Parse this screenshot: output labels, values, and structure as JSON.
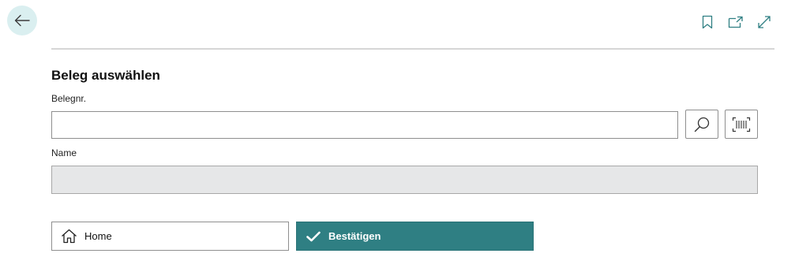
{
  "header": {
    "back_icon": "arrow-left-icon",
    "actions": [
      {
        "icon": "bookmark-icon"
      },
      {
        "icon": "open-in-new-window-icon"
      },
      {
        "icon": "expand-icon"
      }
    ]
  },
  "form": {
    "title": "Beleg auswählen",
    "document_no": {
      "label": "Belegnr.",
      "value": "",
      "search_icon": "search-icon",
      "scan_icon": "barcode-scan-icon"
    },
    "name": {
      "label": "Name",
      "value": ""
    }
  },
  "buttons": {
    "home": {
      "label": "Home",
      "icon": "home-icon"
    },
    "confirm": {
      "label": "Bestätigen",
      "icon": "checkmark-icon"
    }
  },
  "colors": {
    "accent": "#2f7f83",
    "back_button_bg": "#daeff0",
    "icon_teal": "#2f7f83",
    "readonly_field_bg": "#e6e7e8"
  }
}
